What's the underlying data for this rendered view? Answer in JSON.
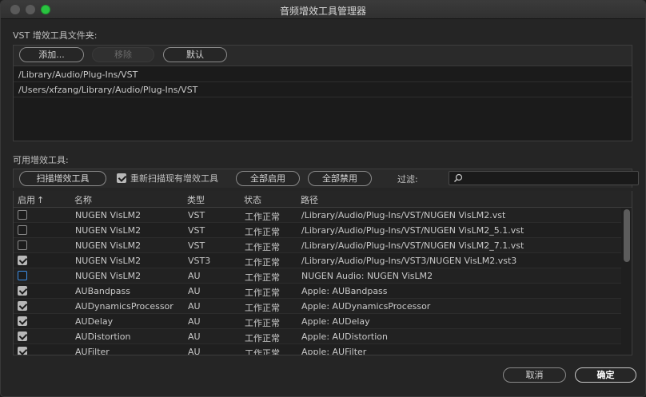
{
  "window": {
    "title": "音频增效工具管理器"
  },
  "vst": {
    "section_label": "VST 增效工具文件夹:",
    "add_label": "添加...",
    "remove_label": "移除",
    "default_label": "默认",
    "folders": [
      "/Library/Audio/Plug-Ins/VST",
      "/Users/xfzang/Library/Audio/Plug-Ins/VST"
    ]
  },
  "available": {
    "section_label": "可用增效工具:",
    "scan_label": "扫描增效工具",
    "rescan_label": "重新扫描现有增效工具",
    "rescan_checked": true,
    "enable_all_label": "全部启用",
    "disable_all_label": "全部禁用",
    "filter_label": "过滤:",
    "filter_value": ""
  },
  "table": {
    "columns": {
      "enabled": "启用",
      "name": "名称",
      "type": "类型",
      "status": "状态",
      "path": "路径"
    },
    "sort_indicator": "↑",
    "rows": [
      {
        "enabled": false,
        "focus": false,
        "name": "NUGEN VisLM2",
        "type": "VST",
        "status": "工作正常",
        "path": "/Library/Audio/Plug-Ins/VST/NUGEN VisLM2.vst"
      },
      {
        "enabled": false,
        "focus": false,
        "name": "NUGEN VisLM2",
        "type": "VST",
        "status": "工作正常",
        "path": "/Library/Audio/Plug-Ins/VST/NUGEN VisLM2_5.1.vst"
      },
      {
        "enabled": false,
        "focus": false,
        "name": "NUGEN VisLM2",
        "type": "VST",
        "status": "工作正常",
        "path": "/Library/Audio/Plug-Ins/VST/NUGEN VisLM2_7.1.vst"
      },
      {
        "enabled": true,
        "focus": false,
        "name": "NUGEN VisLM2",
        "type": "VST3",
        "status": "工作正常",
        "path": "/Library/Audio/Plug-Ins/VST3/NUGEN VisLM2.vst3"
      },
      {
        "enabled": false,
        "focus": true,
        "name": "NUGEN VisLM2",
        "type": "AU",
        "status": "工作正常",
        "path": "NUGEN Audio: NUGEN VisLM2"
      },
      {
        "enabled": true,
        "focus": false,
        "name": "AUBandpass",
        "type": "AU",
        "status": "工作正常",
        "path": "Apple: AUBandpass"
      },
      {
        "enabled": true,
        "focus": false,
        "name": "AUDynamicsProcessor",
        "type": "AU",
        "status": "工作正常",
        "path": "Apple: AUDynamicsProcessor"
      },
      {
        "enabled": true,
        "focus": false,
        "name": "AUDelay",
        "type": "AU",
        "status": "工作正常",
        "path": "Apple: AUDelay"
      },
      {
        "enabled": true,
        "focus": false,
        "name": "AUDistortion",
        "type": "AU",
        "status": "工作正常",
        "path": "Apple: AUDistortion"
      },
      {
        "enabled": true,
        "focus": false,
        "name": "AUFilter",
        "type": "AU",
        "status": "工作正常",
        "path": "Apple: AUFilter"
      }
    ]
  },
  "footer": {
    "cancel_label": "取消",
    "ok_label": "确定"
  }
}
